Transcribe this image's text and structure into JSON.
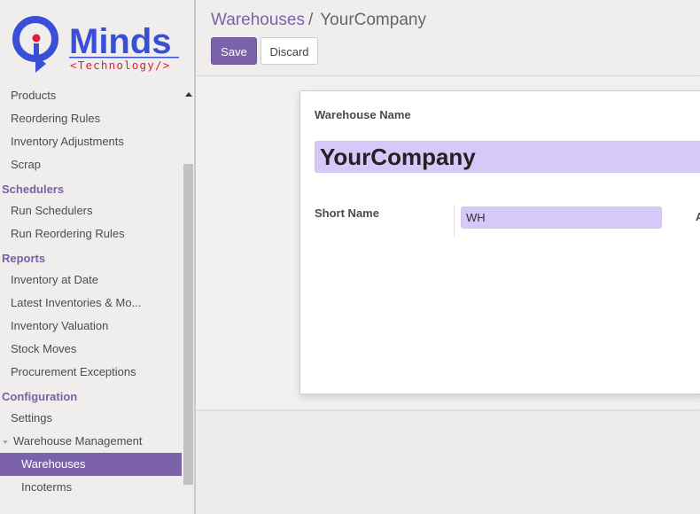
{
  "logo": {
    "brand": "Minds",
    "brand_letter": "Q",
    "tagline": "<Technology/>",
    "colors": {
      "blue": "#3a4fd8",
      "red": "#e31b3a"
    }
  },
  "sidebar": {
    "items": [
      {
        "type": "item",
        "label": "Products"
      },
      {
        "type": "item",
        "label": "Reordering Rules"
      },
      {
        "type": "item",
        "label": "Inventory Adjustments"
      },
      {
        "type": "item",
        "label": "Scrap"
      },
      {
        "type": "header",
        "label": "Schedulers"
      },
      {
        "type": "item",
        "label": "Run Schedulers"
      },
      {
        "type": "item",
        "label": "Run Reordering Rules"
      },
      {
        "type": "header",
        "label": "Reports"
      },
      {
        "type": "item",
        "label": "Inventory at Date"
      },
      {
        "type": "item",
        "label": "Latest Inventories & Mo..."
      },
      {
        "type": "item",
        "label": "Inventory Valuation"
      },
      {
        "type": "item",
        "label": "Stock Moves"
      },
      {
        "type": "item",
        "label": "Procurement Exceptions"
      },
      {
        "type": "header",
        "label": "Configuration"
      },
      {
        "type": "item",
        "label": "Settings"
      },
      {
        "type": "item",
        "label": "Warehouse Management",
        "expanded": true
      },
      {
        "type": "sub",
        "label": "Warehouses",
        "active": true
      },
      {
        "type": "sub",
        "label": "Incoterms"
      }
    ]
  },
  "breadcrumb": {
    "parent": "Warehouses",
    "separator": "/",
    "current": "YourCompany"
  },
  "toolbar": {
    "save_label": "Save",
    "discard_label": "Discard"
  },
  "form": {
    "warehouse_name_label": "Warehouse Name",
    "warehouse_name_value": "YourCompany",
    "short_name_label": "Short Name",
    "short_name_value": "WH",
    "truncated_next_label": "A"
  },
  "colors": {
    "accent": "#7c62a9",
    "input_bg": "#d6c8f9"
  }
}
